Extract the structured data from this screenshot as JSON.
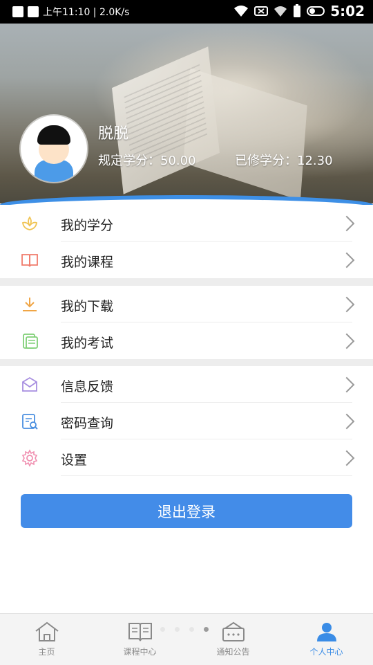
{
  "status_bar": {
    "left_text": "上午11:10 | 2.0K/s",
    "time": "5:02"
  },
  "profile": {
    "username": "脱脱",
    "required_credits_label": "规定学分：",
    "required_credits_value": "50.00",
    "earned_credits_label": "已修学分：",
    "earned_credits_value": "12.30"
  },
  "menu": {
    "group1": [
      {
        "label": "我的学分",
        "icon": "lotus-icon"
      },
      {
        "label": "我的课程",
        "icon": "book-icon"
      }
    ],
    "group2": [
      {
        "label": "我的下载",
        "icon": "download-icon"
      },
      {
        "label": "我的考试",
        "icon": "exam-icon"
      }
    ],
    "group3": [
      {
        "label": "信息反馈",
        "icon": "mail-icon"
      },
      {
        "label": "密码查询",
        "icon": "password-search-icon"
      },
      {
        "label": "设置",
        "icon": "gear-icon"
      }
    ]
  },
  "logout_label": "退出登录",
  "tabs": [
    {
      "label": "主页",
      "icon": "home-icon"
    },
    {
      "label": "课程中心",
      "icon": "open-book-icon"
    },
    {
      "label": "通知公告",
      "icon": "notice-icon"
    },
    {
      "label": "个人中心",
      "icon": "person-icon"
    }
  ],
  "colors": {
    "accent": "#438ce8",
    "tab_active": "#3a8ce6"
  }
}
